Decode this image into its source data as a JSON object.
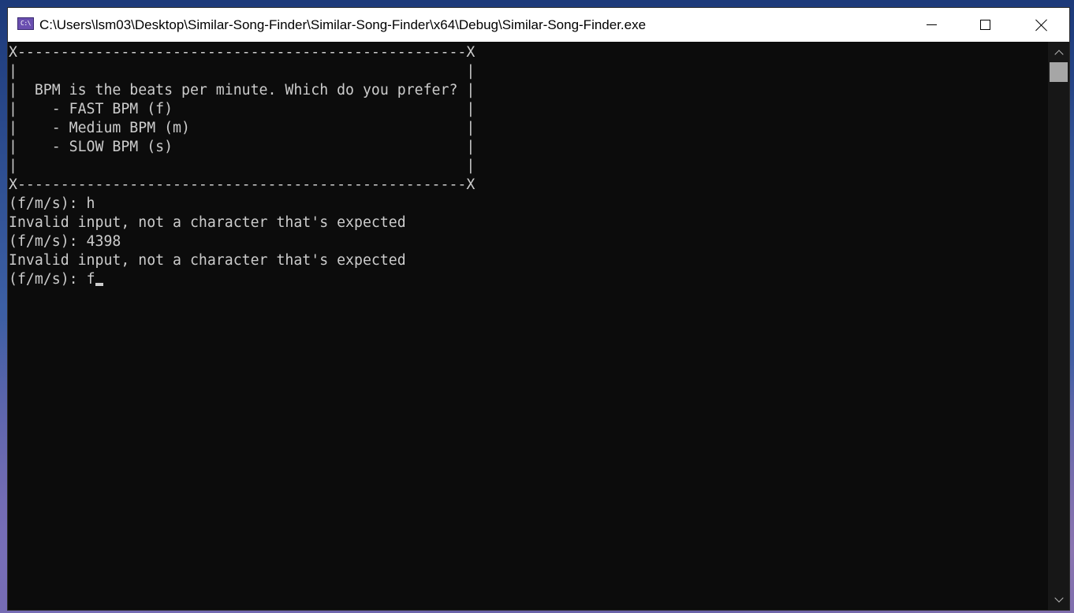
{
  "window": {
    "title": "C:\\Users\\lsm03\\Desktop\\Similar-Song-Finder\\Similar-Song-Finder\\x64\\Debug\\Similar-Song-Finder.exe",
    "icon": "console-app-icon",
    "icon_glyph": "C:\\",
    "controls": {
      "minimize": "minimize-icon",
      "maximize": "maximize-icon",
      "close": "close-icon"
    }
  },
  "console": {
    "lines": [
      "X----------------------------------------------------X",
      "|                                                    |",
      "|  BPM is the beats per minute. Which do you prefer? |",
      "|    - FAST BPM (f)                                  |",
      "|    - Medium BPM (m)                                |",
      "|    - SLOW BPM (s)                                  |",
      "|                                                    |",
      "X----------------------------------------------------X",
      "(f/m/s): h",
      "Invalid input, not a character that's expected",
      "(f/m/s): 4398",
      "Invalid input, not a character that's expected"
    ],
    "prompt": "(f/m/s): ",
    "current_input": "f"
  },
  "colors": {
    "console_background": "#0c0c0c",
    "console_text": "#cccccc",
    "titlebar": "#ffffff"
  }
}
